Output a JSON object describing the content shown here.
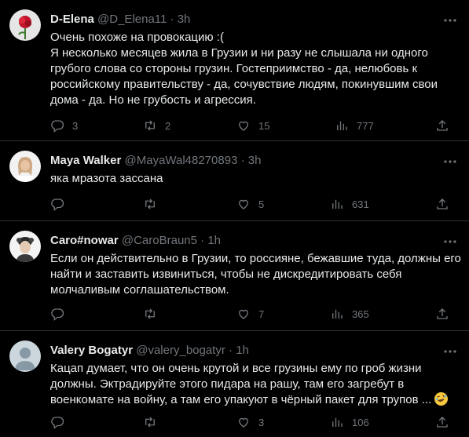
{
  "tweets": [
    {
      "name": "D-Elena",
      "handle": "@D_Elena11",
      "sep": "·",
      "time": "3h",
      "lines": [
        "Очень похоже на провокацию :(",
        "Я несколько месяцев жила в Грузии и ни разу не слышала ни одного",
        "грубого слова со стороны грузин. Гостеприимство - да, нелюбовь к",
        "российскому правительству - да, сочувствие людям, покинувшим свои",
        "дома - да. Но не грубость и агрессия."
      ],
      "replies": "3",
      "retweets": "2",
      "likes": "15",
      "views": "777"
    },
    {
      "name": "Maya Walker",
      "handle": "@MayaWal48270893",
      "sep": "·",
      "time": "3h",
      "lines": [
        "яка мразота зассана"
      ],
      "replies": "",
      "retweets": "",
      "likes": "5",
      "views": "631"
    },
    {
      "name": "Caro#nowar",
      "handle": "@CaroBraun5",
      "sep": "·",
      "time": "1h",
      "lines": [
        "Если он действительно в Грузии, то россияне, бежавшие туда, должны его",
        "найти и заставить извиниться, чтобы не дискредитировать себя",
        "молчаливым соглашательством."
      ],
      "replies": "",
      "retweets": "",
      "likes": "7",
      "views": "365"
    },
    {
      "name": "Valery Bogatyr",
      "handle": "@valery_bogatyr",
      "sep": "·",
      "time": "1h",
      "lines": [
        "Кацап думает, что он очень крутой и все грузины ему по гроб жизни",
        "должны. Эктрадируйте этого пидара на рашу, там его загребут в",
        "военкомате на войну, а там его упакуют в чёрный пакет для трупов ..."
      ],
      "emoji": "rolling-on-floor-laughing-emoji",
      "replies": "",
      "retweets": "",
      "likes": "3",
      "views": "106"
    }
  ],
  "colors": {
    "background": "#000000",
    "text": "#e7e9ea",
    "muted": "#71767b",
    "divider": "#2f3336"
  }
}
